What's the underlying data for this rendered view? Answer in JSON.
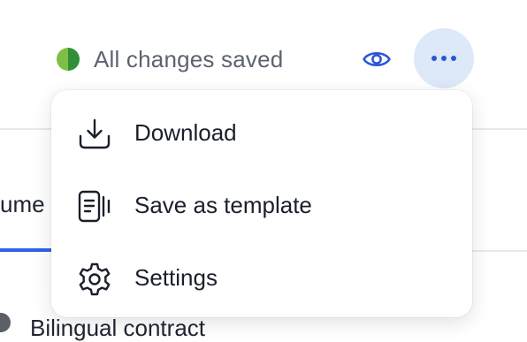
{
  "header": {
    "save_status": {
      "text": "All changes saved",
      "indicator_colors": [
        "#7fbf45",
        "#2f8f3a"
      ]
    },
    "preview_button": {
      "icon": "eye-icon"
    },
    "more_button": {
      "icon": "more-horizontal-icon"
    }
  },
  "menu": {
    "items": [
      {
        "label": "Download",
        "icon": "download-icon"
      },
      {
        "label": "Save as template",
        "icon": "template-icon"
      },
      {
        "label": "Settings",
        "icon": "gear-icon"
      }
    ]
  },
  "background": {
    "tab_fragment": "ume",
    "document_title_fragment": "Bilingual contract"
  },
  "colors": {
    "accent": "#2f62e8",
    "more_button_bg": "#dde8f8",
    "icon_blue": "#2b56d6"
  }
}
